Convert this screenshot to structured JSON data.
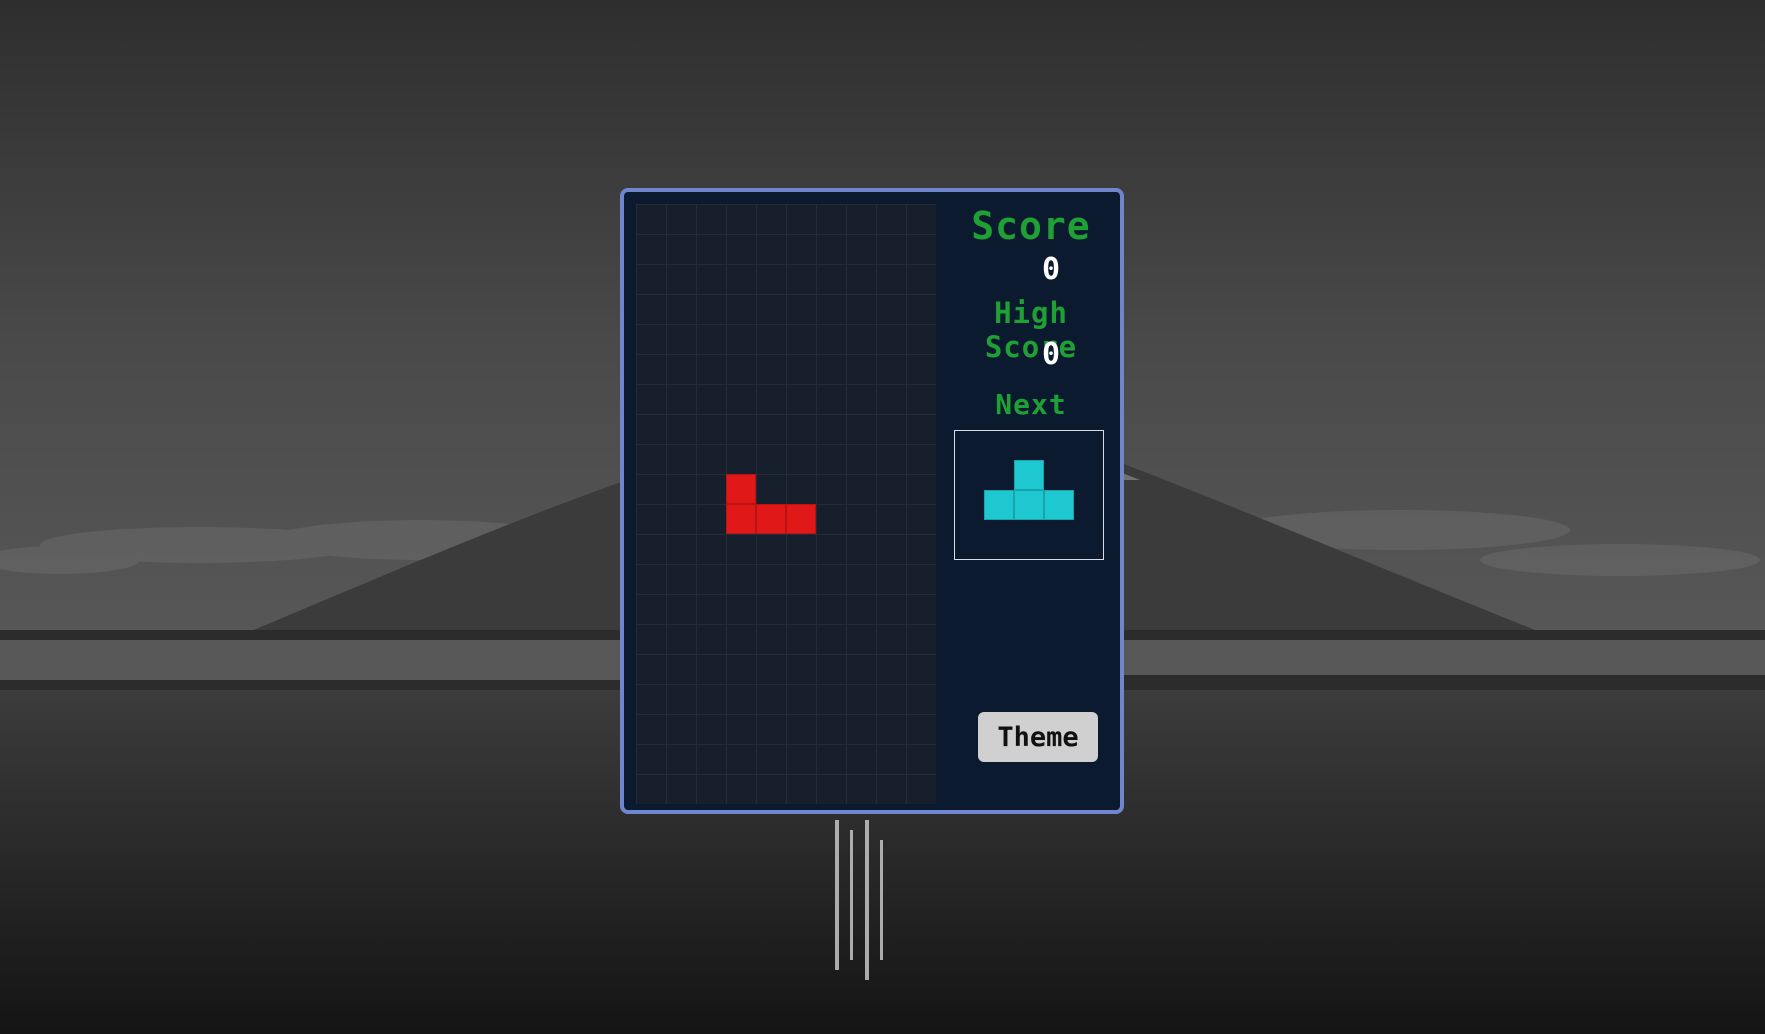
{
  "colors": {
    "frame_border": "#6f86cf",
    "panel_background": "#0c1a30",
    "board_background": "#181f2c",
    "label_green": "#1fa035",
    "value_white": "#ffffff",
    "button_background": "#d0d0d0"
  },
  "sidebar": {
    "score_label": "Score",
    "score_value": "0",
    "high_score_label": "High Score",
    "high_score_value": "0",
    "next_label": "Next",
    "theme_button_label": "Theme"
  },
  "board": {
    "columns": 10,
    "rows": 20,
    "active_piece": {
      "shape": "J",
      "color": "#e01818",
      "cells": [
        [
          3,
          9
        ],
        [
          3,
          10
        ],
        [
          4,
          10
        ],
        [
          5,
          10
        ]
      ]
    }
  },
  "next_piece": {
    "shape": "T",
    "color": "#1ec8d0",
    "cells": [
      [
        1,
        0
      ],
      [
        0,
        1
      ],
      [
        1,
        1
      ],
      [
        2,
        1
      ]
    ]
  },
  "background": {
    "icon": "mountain-lake-scene"
  }
}
